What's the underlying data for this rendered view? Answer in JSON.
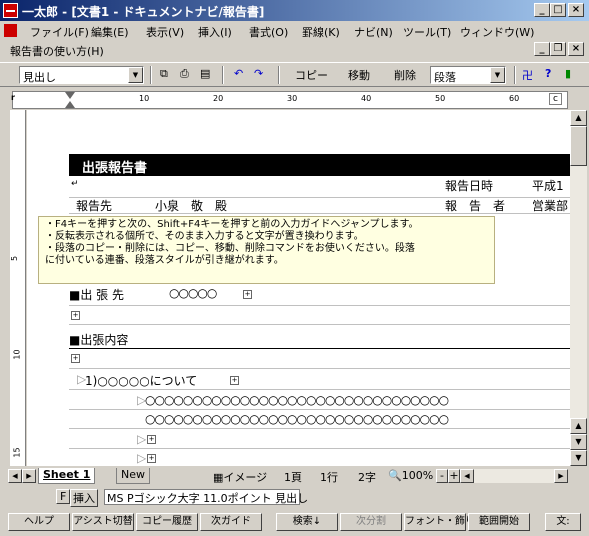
{
  "window": {
    "title": "一太郎 - [文書1 - ドキュメントナビ/報告書]"
  },
  "menu": [
    "ファイル(F)",
    "編集(E)",
    "表示(V)",
    "挿入(I)",
    "書式(O)",
    "罫線(K)",
    "ナビ(N)",
    "ツール(T)",
    "ウィンドウ(W)"
  ],
  "docbar": {
    "title": "報告書の使い方(H)"
  },
  "toolbar": {
    "style_value": "見出し",
    "copy": "コピー",
    "move": "移動",
    "delete": "削除",
    "paragraph_value": "段落"
  },
  "ruler": {
    "marks": [
      "10",
      "20",
      "30",
      "40",
      "50",
      "60"
    ]
  },
  "vruler": {
    "marks": [
      "5",
      "10",
      "15"
    ]
  },
  "document": {
    "heading": "出張報告書",
    "report_to_label": "報告先",
    "report_to_value": "小泉　敬　殿",
    "date_label": "報告日時",
    "date_value": "平成1",
    "reporter_label": "報　告　者",
    "reporter_value": "営業部",
    "destination_label": "■出 張 先",
    "destination_value": "○○○○○",
    "content_label": "■出張内容",
    "item1": "1)○○○○○について",
    "circle_line": "○○○○○○○○○○○○○○○○○○○○○○○○○○○○○○○○"
  },
  "guide": {
    "line1": "・F4キーを押すと次の、Shift+F4キーを押すと前の入力ガイドへジャンプします。",
    "line2": "・反転表示される個所で、そのまま入力すると文字が置き換わります。",
    "line3": "・段落のコピー・削除には、コピー、移動、削除コマンドをお使いください。段落",
    "line4": "に付いている連番、段落スタイルが引き継がれます。"
  },
  "tabs": {
    "sheet1": "Sheet 1",
    "new": "New"
  },
  "status": {
    "view": "イメージ",
    "page": "1頁",
    "line": "1行",
    "col": "2字",
    "zoom": "100%"
  },
  "inputbar": {
    "mode_f": "F",
    "insert": "挿入",
    "font": "MS Pゴシック大字",
    "size": "11.0ポイント",
    "style": "見出し"
  },
  "fnkeys": [
    "ヘルプ",
    "アシスト切替",
    "コピー履歴",
    "次ガイド",
    "検索↓",
    "次分割",
    "フォント・飾り",
    "範囲開始",
    "文:"
  ]
}
